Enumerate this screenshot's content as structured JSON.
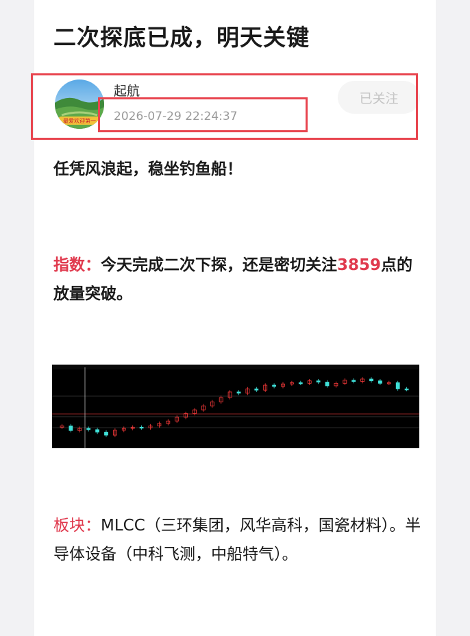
{
  "article": {
    "title": "二次探底已成，明天关键",
    "author": {
      "name": "起航",
      "avatar_banner": "最爱欢迎第一"
    },
    "timestamp": "2026-07-29 22:24:37",
    "follow_label": "已关注",
    "slogan": "任凭风浪起，稳坐钓鱼船！",
    "index_section": {
      "label": "指数：",
      "text_1": "今天完成二次下探，还是密切关注",
      "highlight_number": "3859",
      "text_2": "点的放量突破。"
    },
    "sector_section": {
      "label": "板块：",
      "text": "MLCC（三环集团，风华高科，国瓷材料）。半导体设备（中科飞测，中船特气）。"
    }
  },
  "chart_data": {
    "type": "candlestick",
    "background": "#000000",
    "up_color": "#ff3b3b",
    "down_color": "#3fe0d8",
    "close_approx": [
      3720,
      3705,
      3712,
      3708,
      3700,
      3690,
      3706,
      3712,
      3716,
      3714,
      3720,
      3728,
      3736,
      3748,
      3760,
      3772,
      3785,
      3798,
      3812,
      3830,
      3826,
      3840,
      3836,
      3852,
      3848,
      3856,
      3860,
      3858,
      3866,
      3862,
      3850,
      3858,
      3868,
      3864,
      3872,
      3866,
      3858,
      3860,
      3840,
      3838
    ],
    "colors": {
      "accent_red": "#e03a4e",
      "highlight_box": "#e8454f"
    }
  }
}
